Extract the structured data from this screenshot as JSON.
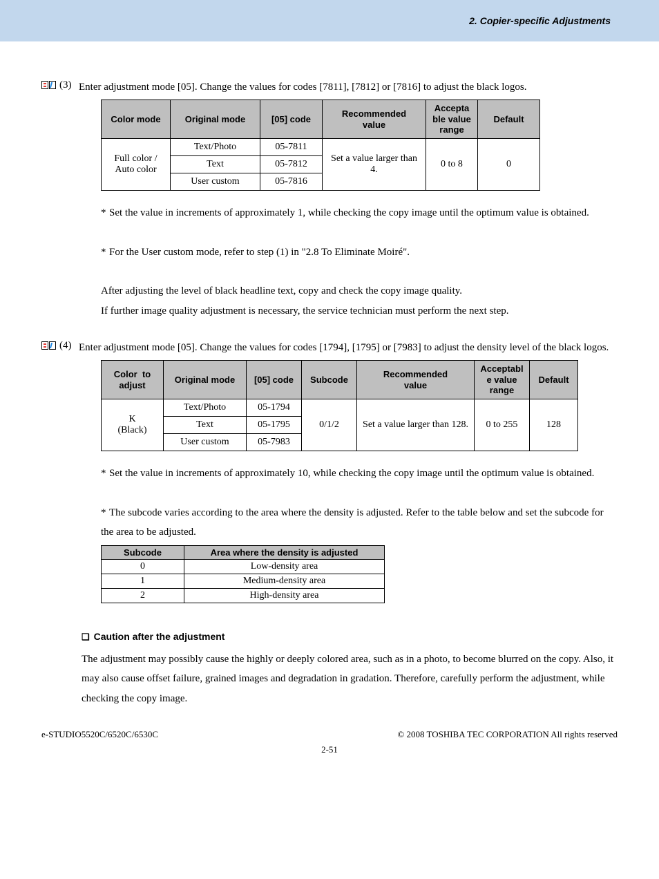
{
  "header": {
    "title": "2. Copier-specific Adjustments"
  },
  "steps": {
    "s3": {
      "num": "(3)",
      "text": "Enter adjustment mode [05]. Change the values for codes [7811], [7812] or [7816] to adjust the black logos."
    },
    "s4": {
      "num": "(4)",
      "text": "Enter adjustment mode [05]. Change the values for codes [1794], [1795] or [7983] to adjust the density level of the black logos."
    }
  },
  "table1": {
    "headers": [
      "Color mode",
      "Original mode",
      "[05] code",
      "Recommended value",
      "Acceptable value range",
      "Default"
    ],
    "color_mode": "Full color / Auto color",
    "rows": [
      {
        "original": "Text/Photo",
        "code": "05-7811"
      },
      {
        "original": "Text",
        "code": "05-7812"
      },
      {
        "original": "User custom",
        "code": "05-7816"
      }
    ],
    "rec": "Set a value larger than 4.",
    "range": "0 to 8",
    "default": "0"
  },
  "notes1": {
    "a": "Set the value in increments of approximately 1, while checking the copy image until the optimum value is obtained.",
    "b": "For the User custom mode, refer to step (1) in \"2.8 To Eliminate Moiré\".",
    "c": "After adjusting the level of black headline text, copy and check the copy image quality.",
    "d": "If further image quality adjustment is necessary, the service technician must perform the next step."
  },
  "table2": {
    "headers": [
      "Color  to adjust",
      "Original mode",
      "[05] code",
      "Subcode",
      "Recommended value",
      "Acceptable value range",
      "Default"
    ],
    "color_adj": "K (Black)",
    "rows": [
      {
        "original": "Text/Photo",
        "code": "05-1794"
      },
      {
        "original": "Text",
        "code": "05-1795"
      },
      {
        "original": "User custom",
        "code": "05-7983"
      }
    ],
    "subcode": "0/1/2",
    "rec": "Set a value larger than 128.",
    "range": "0 to 255",
    "default": "128"
  },
  "notes2": {
    "a": "Set the value in increments of approximately 10, while checking the copy image until the optimum value is obtained.",
    "b": "The subcode varies according to the area where the density is adjusted.  Refer to the table below and set the subcode for the area to be adjusted."
  },
  "table3": {
    "headers": [
      "Subcode",
      "Area where the density is adjusted"
    ],
    "rows": [
      {
        "sub": "0",
        "area": "Low-density area"
      },
      {
        "sub": "1",
        "area": "Medium-density area"
      },
      {
        "sub": "2",
        "area": "High-density area"
      }
    ]
  },
  "caution": {
    "title": "Caution after the adjustment",
    "body": "The adjustment may possibly cause the highly or deeply colored area, such as in a photo, to become blurred on the copy.  Also, it may also cause offset failure, grained images and degradation in gradation.  Therefore, carefully perform the adjustment, while checking the copy image."
  },
  "footer": {
    "left": "e-STUDIO5520C/6520C/6530C",
    "right": "© 2008 TOSHIBA TEC CORPORATION All rights reserved",
    "page": "2-51"
  }
}
